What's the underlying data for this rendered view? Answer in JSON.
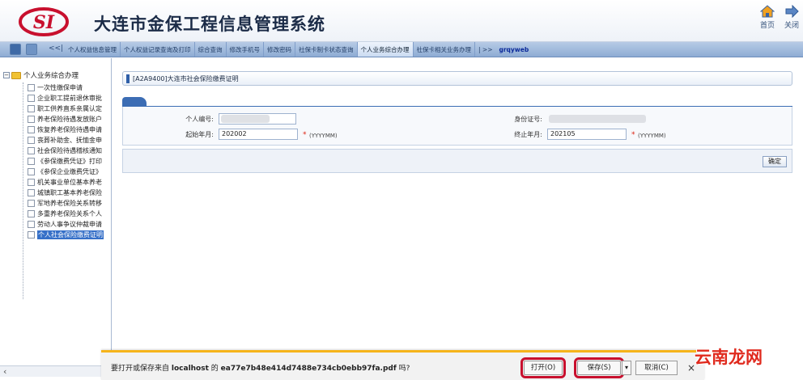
{
  "header": {
    "title": "大连市金保工程信息管理系统",
    "logo_text": "SI",
    "home_label": "首页",
    "close_label": "关闭",
    "accent": "#c8102e"
  },
  "nav": {
    "back_glyph": "<<|",
    "tabs": [
      "个人权益信息管理",
      "个人权益记录查询及打印",
      "综合查询",
      "修改手机号",
      "修改密码",
      "社保卡制卡状态查询",
      "个人业务综合办理",
      "社保卡相关业务办理"
    ],
    "active_tab": "个人业务综合办理",
    "more": "| >>",
    "extra": "grqyweb"
  },
  "sidebar": {
    "root_label": "个人业务综合办理",
    "items": [
      "一次性缴保申请",
      "企业职工提前退休审批",
      "职工供养直系亲属认定",
      "养老保险待遇发放账户",
      "恢复养老保险待遇申请",
      "丧葬补助金、抚恤金申",
      "社会保险待遇稽核通知",
      "《参保缴费凭证》打印",
      "《参保企业缴费凭证》",
      "机关事业单位基本养老",
      "城镇职工基本养老保险",
      "军地养老保险关系转移",
      "多重养老保险关系个人",
      "劳动人事争议仲裁申请",
      "个人社会保险缴费证明"
    ],
    "selected_index": 14
  },
  "main": {
    "panel_title": "[A2A9400]大连市社会保险缴费证明",
    "person_no_label": "个人编号:",
    "id_no_label": "身份证号:",
    "start_label": "起始年月:",
    "start_value": "202002",
    "end_label": "终止年月:",
    "end_value": "202105",
    "required_mark": "*",
    "format_hint": "(YYYYMM)",
    "confirm_label": "确定"
  },
  "download": {
    "prompt_prefix": "要打开或保存来自",
    "host": "localhost",
    "prompt_mid": "的",
    "filename": "ea77e7b48e414d7488e734cb0ebb97fa.pdf",
    "prompt_suffix": "吗?",
    "open_label": "打开(O)",
    "save_label": "保存(S)",
    "dropdown_glyph": "▾",
    "cancel_label": "取消(C)",
    "close_glyph": "×"
  },
  "watermark": "云南龙网"
}
